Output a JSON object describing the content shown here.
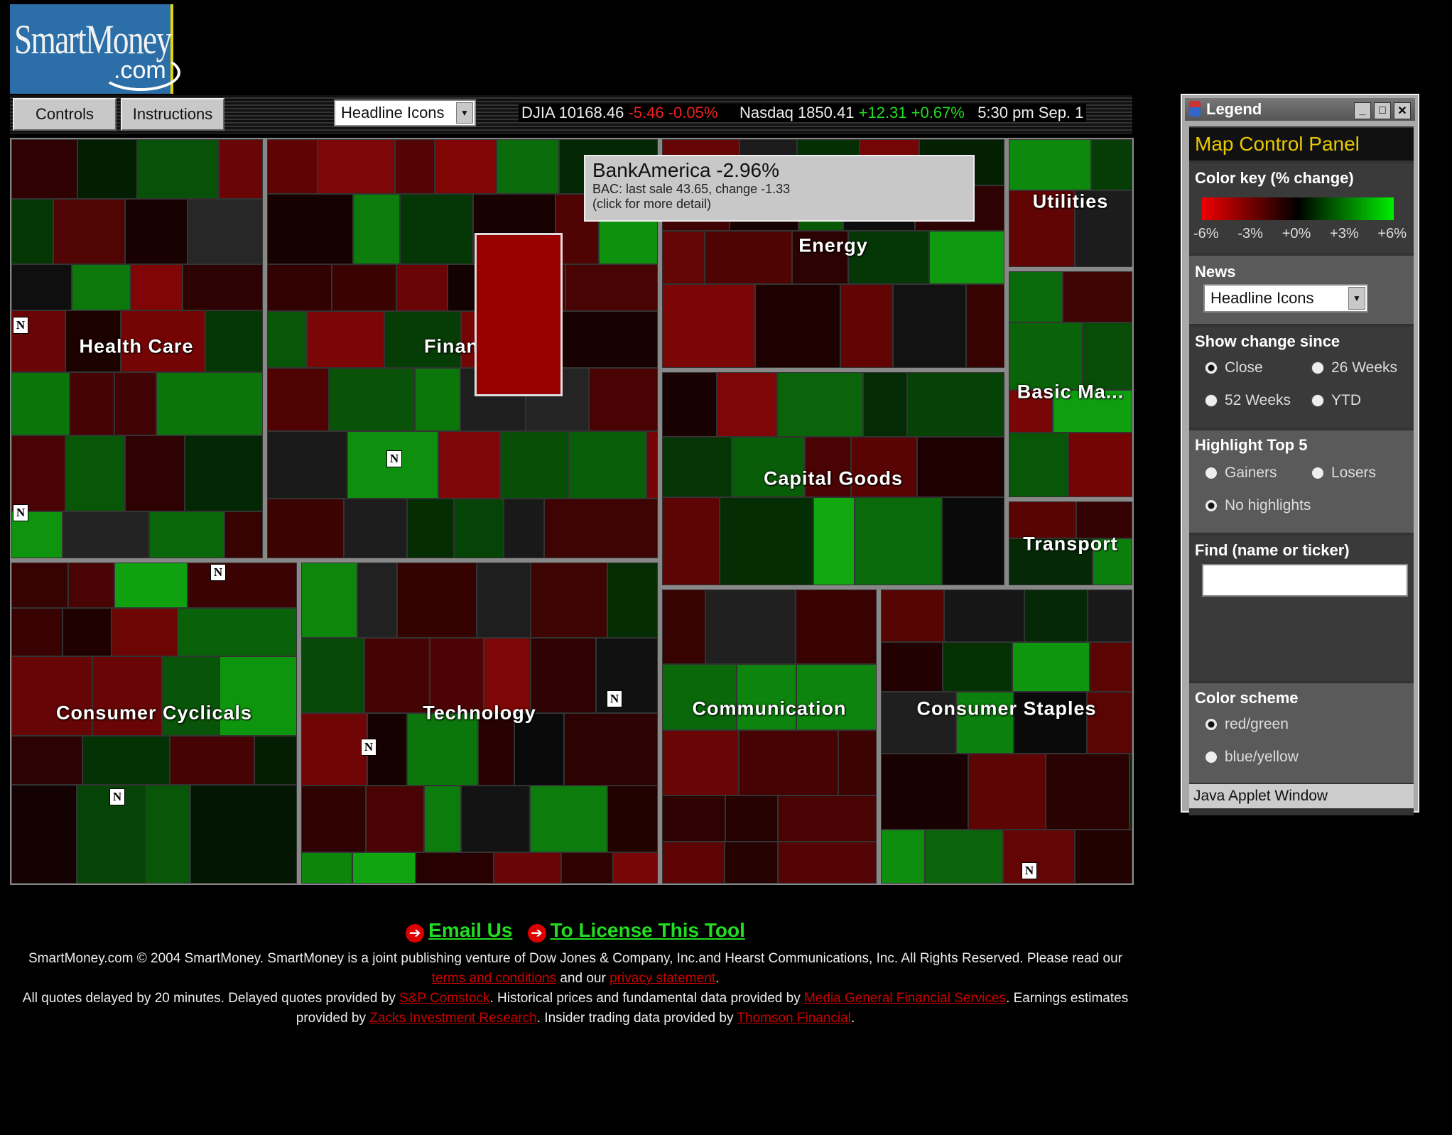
{
  "logo": {
    "line1": "SmartMoney",
    "line2": ".com"
  },
  "toolbar": {
    "controls_label": "Controls",
    "instructions_label": "Instructions",
    "news_select": "Headline Icons",
    "djia_label": "DJIA 10168.46",
    "djia_change": "-5.46 -0.05%",
    "nasdaq_label": "Nasdaq 1850.41",
    "nasdaq_change": "+12.31 +0.67%",
    "time": "5:30 pm  Sep. 1"
  },
  "sectors": [
    {
      "name": "Health Care"
    },
    {
      "name": "Financial"
    },
    {
      "name": "Energy"
    },
    {
      "name": "Utilities"
    },
    {
      "name": "Basic Ma..."
    },
    {
      "name": "Capital Goods"
    },
    {
      "name": "Transport"
    },
    {
      "name": "Consumer Cyclicals"
    },
    {
      "name": "Technology"
    },
    {
      "name": "Communication"
    },
    {
      "name": "Consumer Staples"
    }
  ],
  "news_icon": "N",
  "tooltip": {
    "title": "BankAmerica -2.96%",
    "detail": "BAC: last sale 43.65,  change -1.33",
    "hint": "(click for more detail)"
  },
  "legend": {
    "window_title": "Legend",
    "panel_title": "Map Control Panel",
    "color_key_label": "Color key (% change)",
    "color_key_ticks": [
      "-6%",
      "-3%",
      "+0%",
      "+3%",
      "+6%"
    ],
    "news_label": "News",
    "news_select": "Headline Icons",
    "show_change_label": "Show change since",
    "change_options": [
      "Close",
      "26 Weeks",
      "52 Weeks",
      "YTD"
    ],
    "highlight_label": "Highlight Top 5",
    "highlight_options": [
      "Gainers",
      "Losers",
      "No highlights"
    ],
    "find_label": "Find (name or ticker)",
    "find_value": "",
    "scheme_label": "Color scheme",
    "scheme_options": [
      "red/green",
      "blue/yellow"
    ],
    "status_bar": "Java Applet Window",
    "colors": {
      "negative": "#ee0000",
      "neutral": "#000000",
      "positive": "#00ee00"
    }
  },
  "footer": {
    "email": "Email Us",
    "license": "To License This Tool",
    "p1": "SmartMoney.com © 2004 SmartMoney. SmartMoney is a joint publishing venture of Dow Jones & Company, Inc.and Hearst Communications, Inc. All Rights Reserved. Please read our",
    "terms": "terms and conditions",
    "and_our": "and our",
    "privacy": "privacy statement",
    "p2": "All quotes delayed by 20 minutes. Delayed quotes provided by",
    "sp": "S&P Comstock",
    "p3": ". Historical prices and fundamental data provided by",
    "media": "Media General Financial Services",
    "p4": ". Earnings estimates provided by",
    "zacks": "Zacks Investment Research",
    "p5": ". Insider trading data provided by",
    "thomson": "Thomson Financial"
  }
}
